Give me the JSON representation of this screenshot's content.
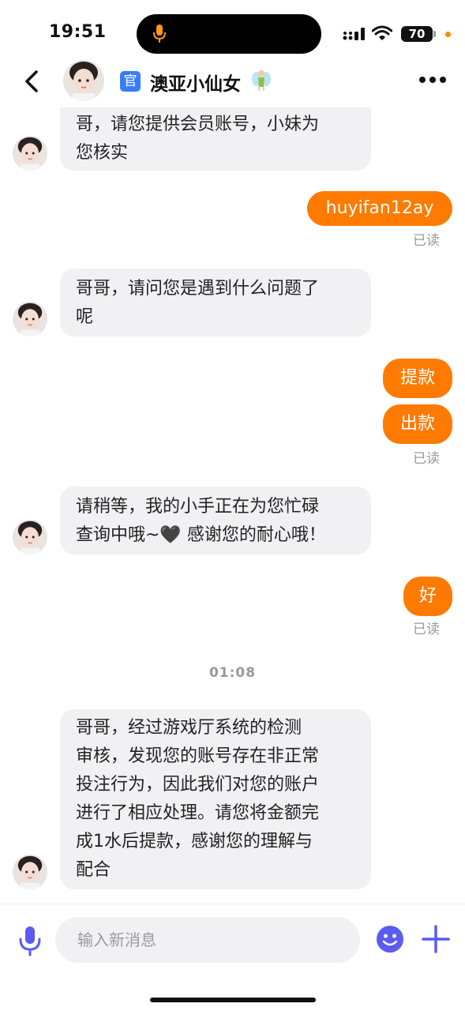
{
  "status_bar": {
    "time": "19:51",
    "battery": "70"
  },
  "header": {
    "badge": "官",
    "title": "澳亚小仙女"
  },
  "messages": [
    {
      "side": "in",
      "lines": [
        "哥，请您提供会员账号，小妹为",
        "您核实"
      ]
    },
    {
      "side": "out",
      "text": "huyifan12ay"
    },
    {
      "side": "read",
      "text": "已读"
    },
    {
      "side": "in",
      "lines": [
        "哥哥，请问您是遇到什么问题了",
        "呢"
      ]
    },
    {
      "side": "out",
      "text": "提款"
    },
    {
      "side": "out",
      "text": "出款"
    },
    {
      "side": "read",
      "text": "已读"
    },
    {
      "side": "in",
      "lines": [
        "请稍等，我的小手正在为您忙碌",
        "查询中哦~🖤 感谢您的耐心哦！"
      ]
    },
    {
      "side": "out",
      "text": "好"
    },
    {
      "side": "read",
      "text": "已读"
    },
    {
      "side": "time",
      "text": "01:08"
    },
    {
      "side": "in",
      "lines": [
        " 哥哥，经过游戏厅系统的检测",
        "审核，发现您的账号存在非正常",
        "投注行为，因此我们对您的账户",
        "进行了相应处理。请您将金额完",
        "成1水后提款，感谢您的理解与",
        "配合"
      ]
    }
  ],
  "input": {
    "placeholder": "输入新消息"
  },
  "colors": {
    "accent": "#ff7a00",
    "bubble_in": "#f1f1f3",
    "icon_blue": "#5b5bf0"
  }
}
